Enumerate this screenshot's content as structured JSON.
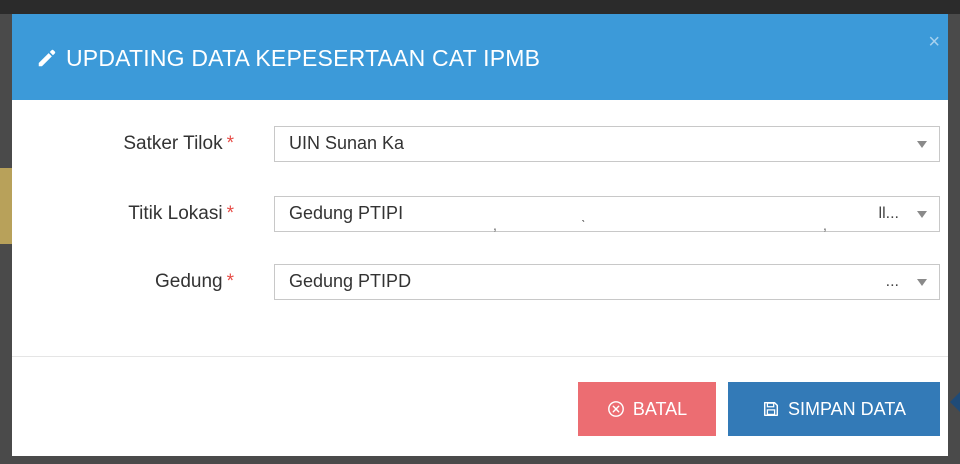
{
  "modal": {
    "title": "UPDATING DATA KEPESERTAAN CAT IPMB",
    "close_label": "×"
  },
  "form": {
    "fields": [
      {
        "label": "Satker Tilok",
        "required": "*",
        "value": "UIN Sunan Ka",
        "tail": ""
      },
      {
        "label": "Titik Lokasi",
        "required": "*",
        "value": "Gedung PTIPI",
        "tail": "ll..."
      },
      {
        "label": "Gedung",
        "required": "*",
        "value": "Gedung PTIPD",
        "tail": "..."
      }
    ]
  },
  "footer": {
    "cancel_label": "BATAL",
    "save_label": "SIMPAN DATA"
  },
  "colors": {
    "header": "#3c9ad9",
    "cancel": "#ec6d72",
    "save": "#337ab7",
    "required": "#e64b45"
  },
  "icons": [
    "pencil-icon",
    "close-icon",
    "chevron-down-icon",
    "circle-x-icon",
    "floppy-disk-icon"
  ]
}
